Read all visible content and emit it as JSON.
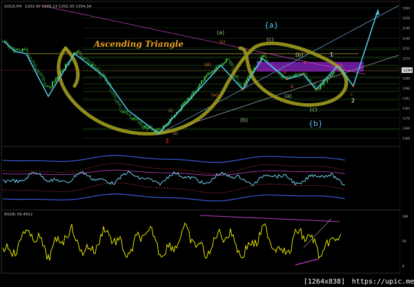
{
  "main_panel": {
    "symbol_header": "GOLD,H4",
    "ohlc_header": "1202.40  1205.13  1202.30  1204.34",
    "current_price_tag": "1204",
    "annotation_title": "Ascending Triangle",
    "wave_labels": {
      "big_a": "{a}",
      "big_b": "{b}",
      "a": "(a)",
      "b": "(b)",
      "c": "(c)",
      "a2": "(a)",
      "b2": "(b)",
      "c2": "(c)",
      "i": "(i)",
      "ii": "(ii)",
      "iii": "(iii)",
      "iv": "(iv)",
      "v": "(v)",
      "num1": "1",
      "num2": "2",
      "num3": "3",
      "sub_a": "a",
      "sub_b": "b",
      "sub_c": "c",
      "sub_e": "e",
      "sub_d": "d",
      "sub_x": "x"
    }
  },
  "osc_panel": {
    "levels": []
  },
  "rsi_panel": {
    "label": "RSI(8) 59.4912"
  },
  "footer": {
    "dims": "[1264x838]",
    "site": "https://upic.me/"
  },
  "colors": {
    "background": "#000000",
    "candle": "#3fbf3f",
    "zigzag": "#4fc8e8",
    "triangle_marker": "#9f9a1e",
    "magenta": "#c040c0",
    "purple_zone": "#7a1fb0",
    "rsi_line": "#e6e600",
    "price_line": "#ff4040"
  },
  "chart_data": [
    {
      "type": "line",
      "title": "GOLD,H4",
      "y_tick_labels": [
        "1264",
        "1256",
        "1248",
        "1240",
        "1232",
        "1224",
        "1216",
        "1208",
        "1200",
        "1192",
        "1184",
        "1176",
        "1168",
        "1160"
      ],
      "ylim": [
        1156,
        1266
      ],
      "zigzag_points": [
        {
          "x": 0,
          "y": 1224
        },
        {
          "x": 14,
          "y": 1208
        },
        {
          "x": 27,
          "y": 1187
        },
        {
          "x": 42,
          "y": 1216
        },
        {
          "x": 90,
          "y": 1172
        },
        {
          "x": 115,
          "y": 1200
        },
        {
          "x": 145,
          "y": 1208
        },
        {
          "x": 168,
          "y": 1178
        },
        {
          "x": 185,
          "y": 1210
        },
        {
          "x": 200,
          "y": 1190
        },
        {
          "x": 210,
          "y": 1200
        },
        {
          "x": 218,
          "y": 1188
        },
        {
          "x": 228,
          "y": 1205
        },
        {
          "x": 244,
          "y": 1185
        },
        {
          "x": 268,
          "y": 1262
        }
      ]
    },
    {
      "type": "line",
      "title": "",
      "note": "oscillator with bands"
    },
    {
      "type": "line",
      "title": "RSI(8) 59.4912",
      "ylim": [
        0,
        100
      ]
    }
  ]
}
